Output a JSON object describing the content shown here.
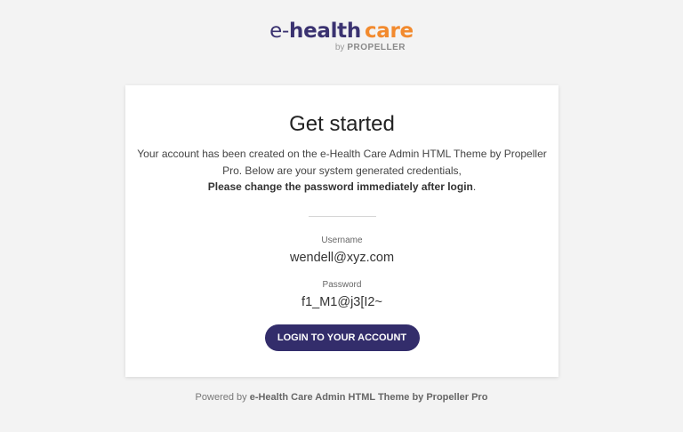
{
  "logo": {
    "prefix": "e-",
    "health": "health",
    "care": "care",
    "by": "by",
    "company": "PROPELLER"
  },
  "card": {
    "title": "Get started",
    "intro_line": "Your account has been created on the e-Health Care Admin HTML Theme by Propeller Pro. Below are your system generated credentials,",
    "intro_bold": "Please change the password immediately after login",
    "intro_end": ".",
    "username_label": "Username",
    "username_value": "wendell@xyz.com",
    "password_label": "Password",
    "password_value": "f1_M1@j3[I2~",
    "login_button": "Login to your account"
  },
  "footer": {
    "prefix": "Powered by ",
    "brand": "e-Health Care Admin HTML Theme by Propeller Pro"
  },
  "colors": {
    "brand_primary": "#332d6b",
    "brand_accent": "#f28a2e",
    "background": "#f3f3f3"
  }
}
